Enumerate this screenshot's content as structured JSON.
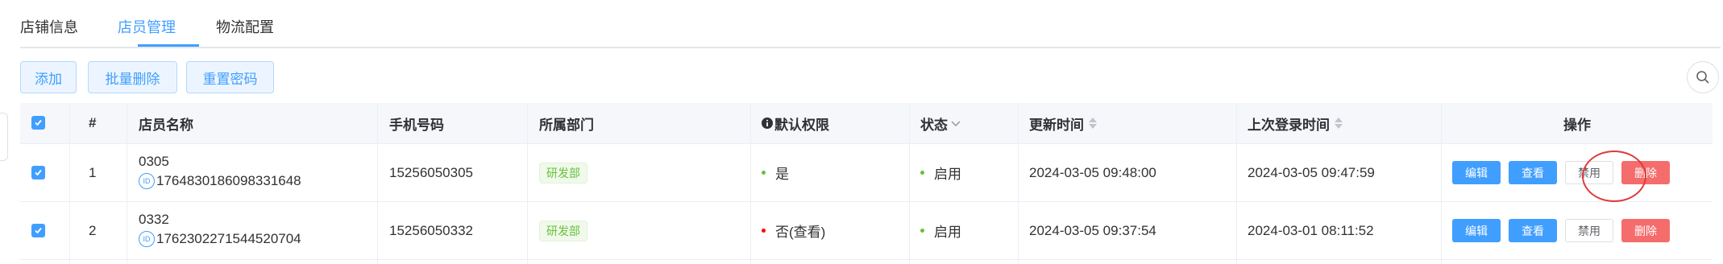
{
  "tabs": [
    "店铺信息",
    "店员管理",
    "物流配置"
  ],
  "toolbar": {
    "add": "添加",
    "batch_delete": "批量删除",
    "reset_password": "重置密码"
  },
  "table": {
    "headers": {
      "index": "#",
      "name": "店员名称",
      "phone": "手机号码",
      "dept": "所属部门",
      "perm": "默认权限",
      "status": "状态",
      "update_time": "更新时间",
      "last_login": "上次登录时间",
      "actions": "操作"
    },
    "rows": [
      {
        "index": "1",
        "name": "0305",
        "id": "1764830186098331648",
        "phone": "15256050305",
        "dept": "研发部",
        "perm": "是",
        "perm_color": "#67c23a",
        "status": "启用",
        "update_time": "2024-03-05 09:48:00",
        "last_login": "2024-03-05 09:47:59"
      },
      {
        "index": "2",
        "name": "0332",
        "id": "1762302271544520704",
        "phone": "15256050332",
        "dept": "研发部",
        "perm": "否(查看)",
        "perm_color": "#f00",
        "status": "启用",
        "update_time": "2024-03-05 09:37:54",
        "last_login": "2024-03-01 08:11:52"
      }
    ],
    "row_buttons": {
      "edit": "编辑",
      "view": "查看",
      "disable": "禁用",
      "delete": "删除"
    },
    "id_badge": "ID"
  }
}
